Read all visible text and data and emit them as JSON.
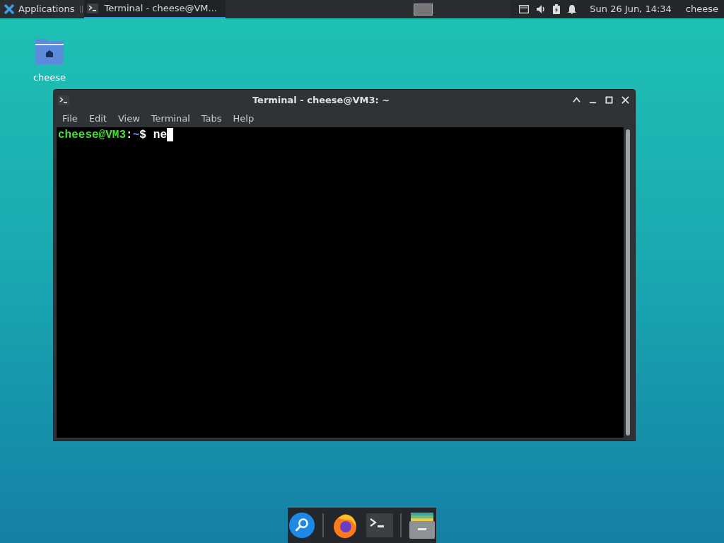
{
  "panel": {
    "menu_label": "Applications",
    "tasks": [
      {
        "title": "Terminal - cheese@VM...",
        "selected": true
      }
    ],
    "workspaces": [
      {
        "selected": true
      }
    ],
    "clock": "Sun 26 Jun, 14:34",
    "user": "cheese"
  },
  "desktop_icons": [
    {
      "label": "cheese"
    }
  ],
  "window": {
    "title": "Terminal - cheese@VM3: ~",
    "menu": [
      "File",
      "Edit",
      "View",
      "Terminal",
      "Tabs",
      "Help"
    ],
    "terminal": {
      "user_host": "cheese@VM3",
      "separator": ":",
      "path": "~",
      "symbol": "$",
      "input": "ne"
    }
  },
  "dock": [
    {
      "kind": "search"
    },
    {
      "kind": "browser"
    },
    {
      "kind": "terminal"
    },
    {
      "kind": "files"
    }
  ]
}
